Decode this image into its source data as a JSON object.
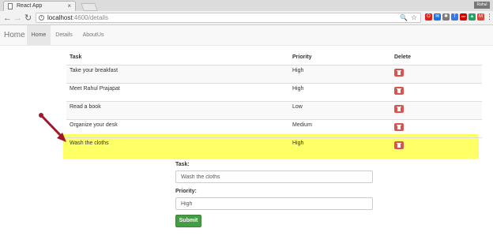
{
  "browser": {
    "tab_title": "React App",
    "tab_close": "×",
    "profile_badge": "Rahul",
    "back_glyph": "←",
    "forward_glyph": "→",
    "reload_glyph": "↻",
    "url_host": "localhost",
    "url_path": ":4600/details",
    "zoom_glyph": "🔍",
    "star_glyph": "☆",
    "extensions": [
      {
        "name": "opera-icon",
        "color": "#e0201b",
        "glyph": "O"
      },
      {
        "name": "extension-icon",
        "color": "#1a73e8",
        "glyph": "✉"
      },
      {
        "name": "puzzle-icon",
        "color": "#7b7b7b",
        "glyph": "✱"
      },
      {
        "name": "translate-icon",
        "color": "#3b78e7",
        "glyph": "T"
      },
      {
        "name": "adblock-icon",
        "color": "#d40000",
        "glyph": "ABP"
      },
      {
        "name": "drive-icon",
        "color": "#1da462",
        "glyph": "▲"
      },
      {
        "name": "gmail-icon",
        "color": "#db4437",
        "glyph": "M"
      },
      {
        "name": "menu-icon",
        "color": "#f2f2f2",
        "glyph": "⋮"
      }
    ]
  },
  "navbar": {
    "brand": "Home",
    "links": [
      {
        "label": "Home",
        "active": true
      },
      {
        "label": "Details",
        "active": false
      },
      {
        "label": "AboutUs",
        "active": false
      }
    ]
  },
  "table": {
    "headers": {
      "task": "Task",
      "priority": "Priority",
      "delete": "Delete"
    },
    "rows": [
      {
        "task": "Take your breakfast",
        "priority": "High"
      },
      {
        "task": "Meet Rahul Prajapat",
        "priority": "High"
      },
      {
        "task": "Read a book",
        "priority": "Low"
      },
      {
        "task": "Organize your desk",
        "priority": "Medium"
      },
      {
        "task": "Wash the cloths",
        "priority": "High"
      }
    ],
    "highlight_color": "#ffff66",
    "delete_color": "#d9534f"
  },
  "form": {
    "task_label": "Task:",
    "task_value": "Wash the cloths",
    "priority_label": "Priority:",
    "priority_value": "High",
    "submit_label": "Submit",
    "submit_color": "#449d44"
  },
  "annotation": {
    "arrow_color": "#a0182a"
  }
}
